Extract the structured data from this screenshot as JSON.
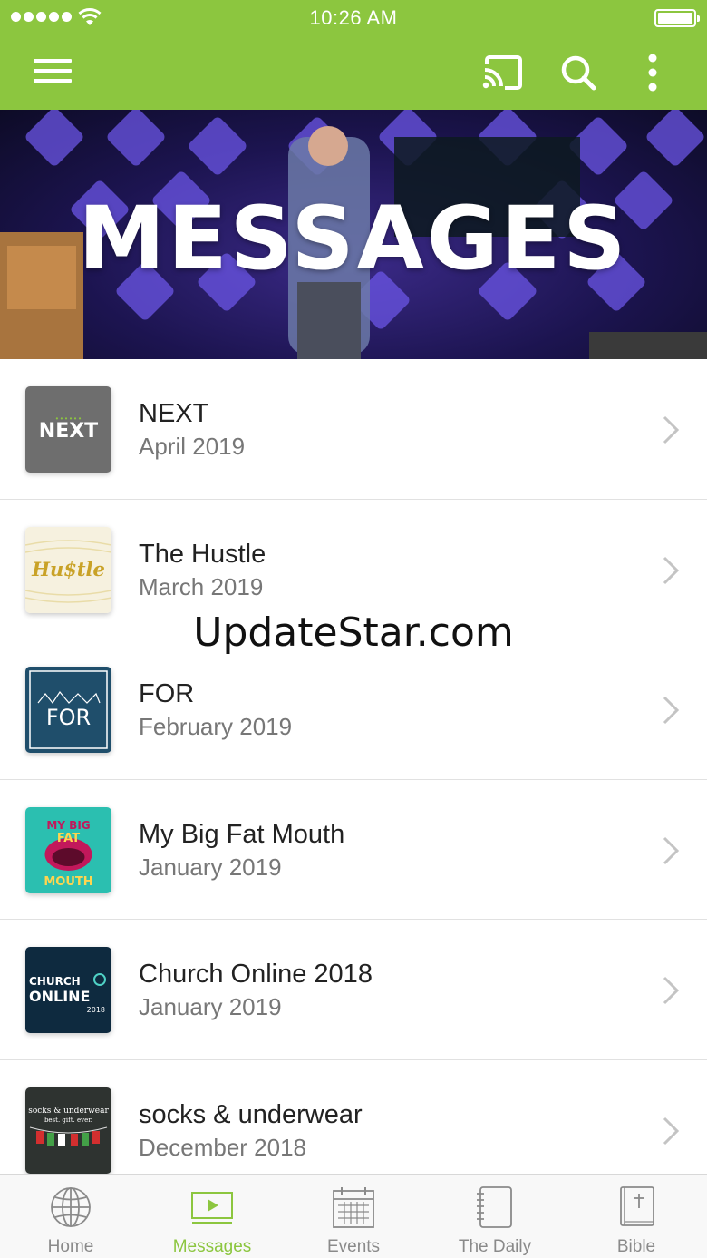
{
  "status_bar": {
    "time": "10:26 AM"
  },
  "app_bar": {
    "menu_icon": "hamburger-menu-icon",
    "cast_icon": "cast-icon",
    "search_icon": "search-icon",
    "more_icon": "more-vertical-icon",
    "color": "#8cc63f"
  },
  "hero": {
    "title": "MESSAGES"
  },
  "messages": [
    {
      "title": "NEXT",
      "date": "April 2019",
      "thumb_text": "NEXT"
    },
    {
      "title": "The Hustle",
      "date": "March 2019",
      "thumb_text": "Hu$tle"
    },
    {
      "title": "FOR",
      "date": "February 2019",
      "thumb_text": "FOR"
    },
    {
      "title": "My Big Fat Mouth",
      "date": "January 2019",
      "thumb_text_line1": "MY BIG",
      "thumb_text_line2": "FAT",
      "thumb_text_line3": "MOUTH"
    },
    {
      "title": "Church Online 2018",
      "date": "January 2019",
      "thumb_text_line1": "CHURCH",
      "thumb_text_line2": "ONLINE",
      "thumb_text_line3": "2018"
    },
    {
      "title": "socks & underwear",
      "date": "December 2018",
      "thumb_text_line1": "socks & underwear",
      "thumb_text_line2": "best. gift. ever."
    }
  ],
  "watermark": "UpdateStar.com",
  "tabs": [
    {
      "label": "Home",
      "icon": "globe-icon"
    },
    {
      "label": "Messages",
      "icon": "video-play-icon",
      "active": true
    },
    {
      "label": "Events",
      "icon": "calendar-icon"
    },
    {
      "label": "The Daily",
      "icon": "notebook-icon"
    },
    {
      "label": "Bible",
      "icon": "bible-icon"
    }
  ],
  "colors": {
    "accent": "#8cc63f",
    "inactive_tab": "#8a8a8a"
  }
}
